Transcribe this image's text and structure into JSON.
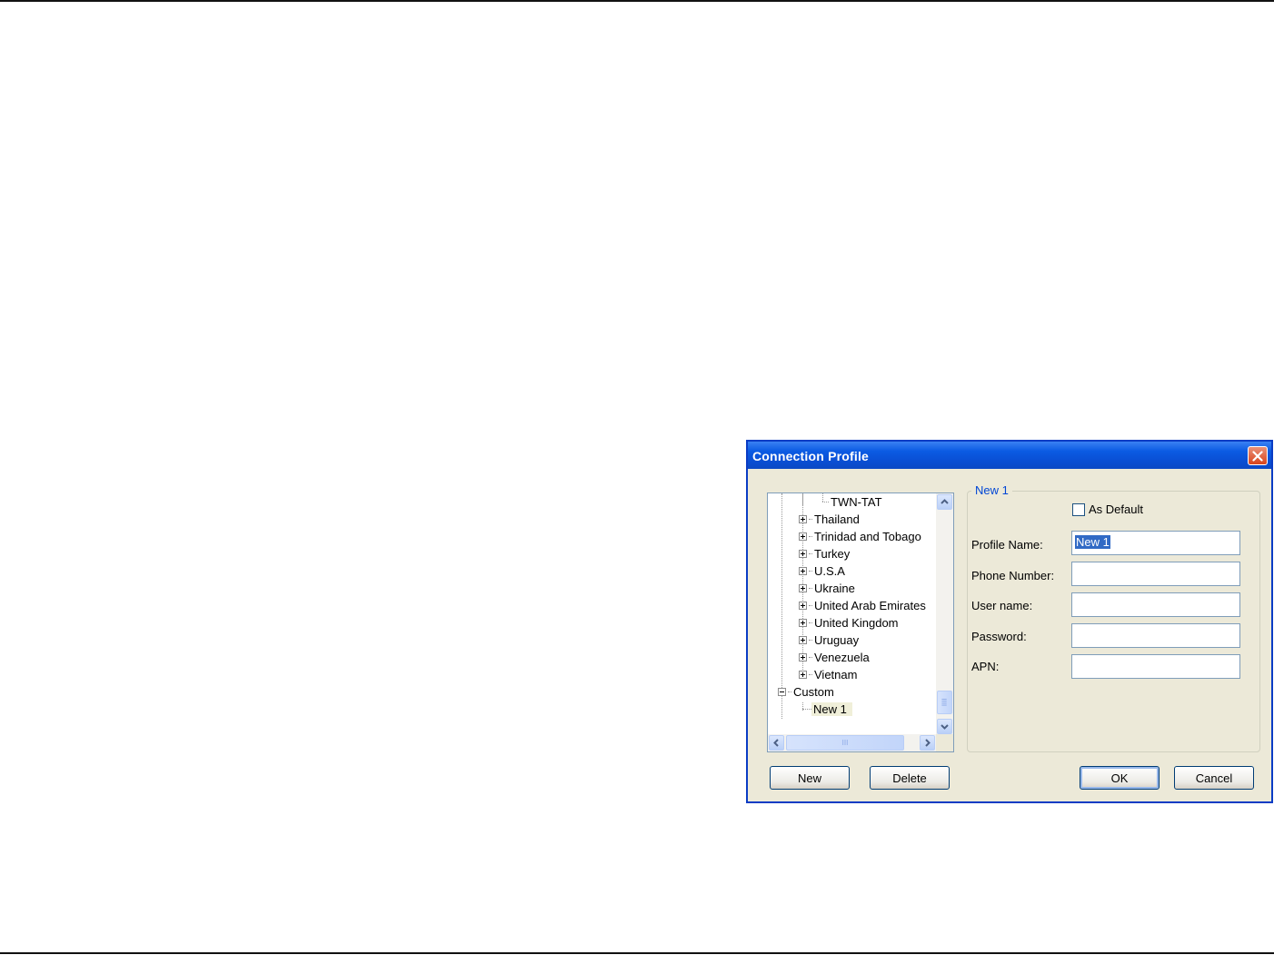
{
  "dialog": {
    "title": "Connection Profile",
    "tree": {
      "items": [
        {
          "label": "TWN-TAT",
          "kind": "leaf"
        },
        {
          "label": "Thailand",
          "kind": "collapsed"
        },
        {
          "label": "Trinidad and Tobago",
          "kind": "collapsed"
        },
        {
          "label": "Turkey",
          "kind": "collapsed"
        },
        {
          "label": "U.S.A",
          "kind": "collapsed"
        },
        {
          "label": "Ukraine",
          "kind": "collapsed"
        },
        {
          "label": "United Arab Emirates",
          "kind": "collapsed"
        },
        {
          "label": "United Kingdom",
          "kind": "collapsed"
        },
        {
          "label": "Uruguay",
          "kind": "collapsed"
        },
        {
          "label": "Venezuela",
          "kind": "collapsed"
        },
        {
          "label": "Vietnam",
          "kind": "collapsed"
        },
        {
          "label": "Custom",
          "kind": "expanded"
        },
        {
          "label": "New 1",
          "kind": "selected-leaf"
        }
      ],
      "hscroll_glyph": "III"
    },
    "group": {
      "legend": "New 1",
      "as_default_label": "As Default",
      "as_default_checked": false,
      "fields": {
        "profile_name": {
          "label": "Profile Name:",
          "value": "New 1"
        },
        "phone_number": {
          "label": "Phone Number:",
          "value": ""
        },
        "user_name": {
          "label": "User name:",
          "value": ""
        },
        "password": {
          "label": "Password:",
          "value": ""
        },
        "apn": {
          "label": "APN:",
          "value": ""
        }
      }
    },
    "buttons": {
      "new": "New",
      "delete": "Delete",
      "ok": "OK",
      "cancel": "Cancel"
    },
    "colors": {
      "title_bar": "#0b5be3",
      "legend_text": "#0046d5",
      "close_button": "#d9441b",
      "selection": "#316ac5"
    }
  }
}
